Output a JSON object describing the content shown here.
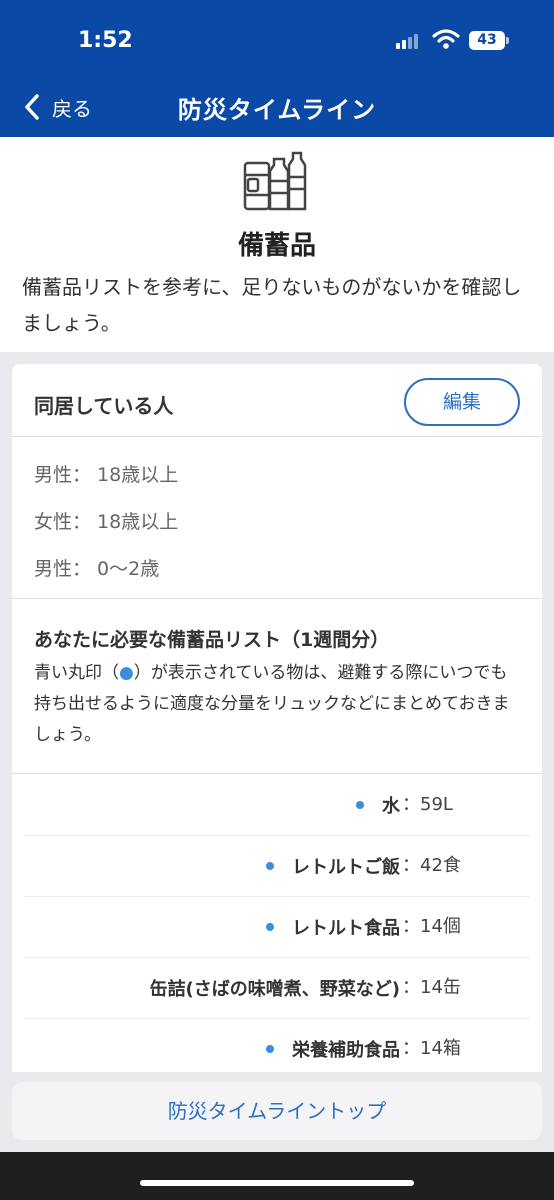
{
  "status_bar": {
    "time": "1:52",
    "battery": "43"
  },
  "nav": {
    "back_label": "戻る",
    "title": "防災タイムライン"
  },
  "hero": {
    "title": "備蓄品",
    "description": "備蓄品リストを参考に、足りないものがないかを確認しましょう。"
  },
  "household": {
    "title": "同居している人",
    "edit_label": "編集",
    "members": [
      "男性： 18歳以上",
      "女性： 18歳以上",
      "男性： 0〜2歳"
    ]
  },
  "needed": {
    "title": "あなたに必要な備蓄品リスト（1週間分）",
    "note_before": "青い丸印（",
    "note_dot": "●",
    "note_after": "）が表示されている物は、避難する際にいつでも持ち出せるように適度な分量をリュックなどにまとめておきましょう。"
  },
  "items": [
    {
      "name": "水",
      "qty": "：59L",
      "carry": true
    },
    {
      "name": "レトルトご飯",
      "qty": "：42食",
      "carry": true
    },
    {
      "name": "レトルト食品",
      "qty": "：14個",
      "carry": true
    },
    {
      "name": "缶詰(さばの味噌煮、野菜など)",
      "qty": "：14缶",
      "carry": false
    },
    {
      "name": "栄養補助食品",
      "qty": "：14箱",
      "carry": true
    }
  ],
  "bottom": {
    "button_label": "防災タイムライントップ"
  },
  "colors": {
    "header": "#0a4aa6",
    "accent": "#2e6fc2",
    "dot": "#3b8de0"
  }
}
